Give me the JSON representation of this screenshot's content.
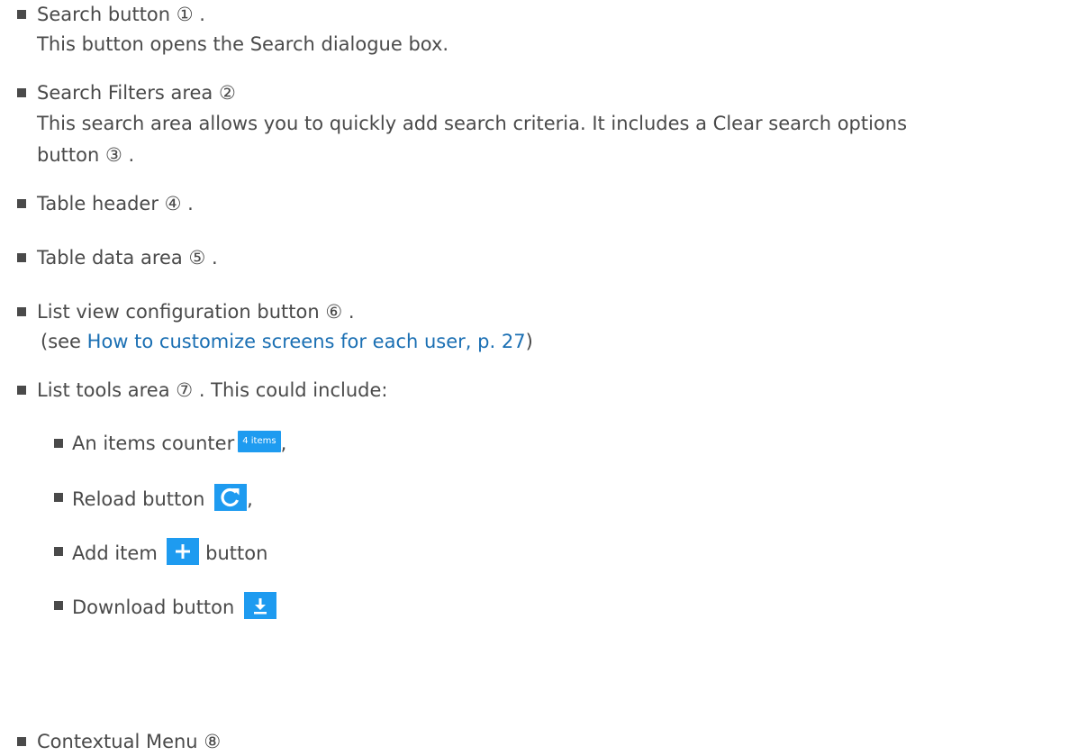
{
  "items": [
    {
      "label": "Search button",
      "marker": "①",
      "suffix": ".",
      "desc": "This button opens the Search dialogue box."
    },
    {
      "label": "Search Filters area",
      "marker": "②",
      "desc1": "This search area allows you to quickly add search criteria. It includes a Clear search options",
      "desc2_prefix": "button",
      "desc2_marker": "③",
      "desc2_suffix": "."
    },
    {
      "label": "Table header",
      "marker": "④",
      "suffix": "."
    },
    {
      "label": "Table data area",
      "marker": "⑤",
      "suffix": "."
    },
    {
      "label": "List view configuration button",
      "marker": "⑥",
      "suffix": ".",
      "see_prefix": "(see",
      "see_link": "How to customize screens for each user, p. 27",
      "see_suffix": ")"
    },
    {
      "label": "List tools area",
      "marker": "⑦",
      "suffix": ".  This could include:"
    },
    {
      "label": "Contextual Menu",
      "marker": "⑧"
    }
  ],
  "subitems": [
    {
      "label": "An items counter",
      "badge": "4 items",
      "suffix": ","
    },
    {
      "label": "Reload button",
      "icon": "reload-icon",
      "suffix": ","
    },
    {
      "label": "Add item",
      "icon": "plus-icon",
      "suffix": "button"
    },
    {
      "label": "Download button",
      "icon": "download-icon"
    }
  ],
  "colors": {
    "text": "#4a4a4a",
    "link": "#1a6fb3",
    "accent": "#1e9bf0"
  }
}
